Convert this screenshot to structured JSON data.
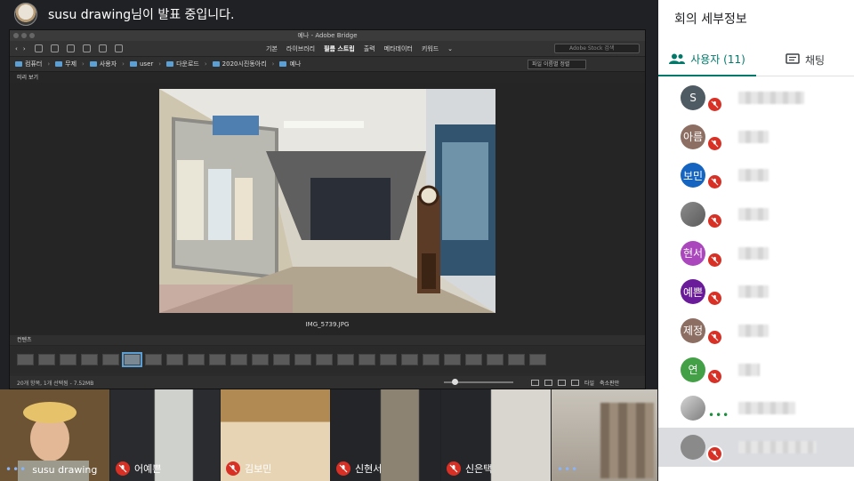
{
  "presenter": {
    "text": "susu drawing님이 발표 중입니다."
  },
  "bridge": {
    "window_title": "예나 - Adobe Bridge",
    "tabs": [
      "기본",
      "라이브러리",
      "필름 스트립",
      "출력",
      "메타데이터",
      "키워드"
    ],
    "active_tab": "필름 스트립",
    "search_placeholder": "Adobe Stock 검색",
    "breadcrumbs": [
      "컴퓨터",
      "무제",
      "사용자",
      "user",
      "다운로드",
      "2020시진동아리",
      "예나"
    ],
    "sort_label": "파일 이름별 정렬",
    "preview_tab": "미리 보기",
    "photo_caption": "IMG_5739.JPG",
    "content_label": "컨텐츠",
    "status_text": "20개 항목, 1개 선택됨 - 7.52MB",
    "view_labels": [
      "타일",
      "축소판만"
    ]
  },
  "tiles": [
    {
      "name": "susu drawing",
      "speaking": true
    },
    {
      "name": "어예쁜",
      "muted": true
    },
    {
      "name": "김보민",
      "muted": true
    },
    {
      "name": "신현서",
      "muted": true
    },
    {
      "name": "신은택",
      "muted": true
    },
    {
      "name": "",
      "speaking": true
    }
  ],
  "panel": {
    "title": "회의 세부정보",
    "tab_users": "사용자 (11)",
    "tab_chat": "채팅",
    "users": [
      {
        "initial": "S",
        "color": "#4f5b62"
      },
      {
        "initial": "아름",
        "color": "#8d6e63"
      },
      {
        "initial": "보민",
        "color": "#1565c0"
      },
      {
        "initial": "",
        "color": "#9e9e9e"
      },
      {
        "initial": "현서",
        "color": "#ab47bc"
      },
      {
        "initial": "예쁜",
        "color": "#6a1b9a"
      },
      {
        "initial": "제정",
        "color": "#8d6e63"
      },
      {
        "initial": "연",
        "color": "#43a047"
      },
      {
        "initial": "",
        "color": "#bdbdbd"
      },
      {
        "initial": "",
        "color": "#8a8a8a"
      }
    ]
  }
}
